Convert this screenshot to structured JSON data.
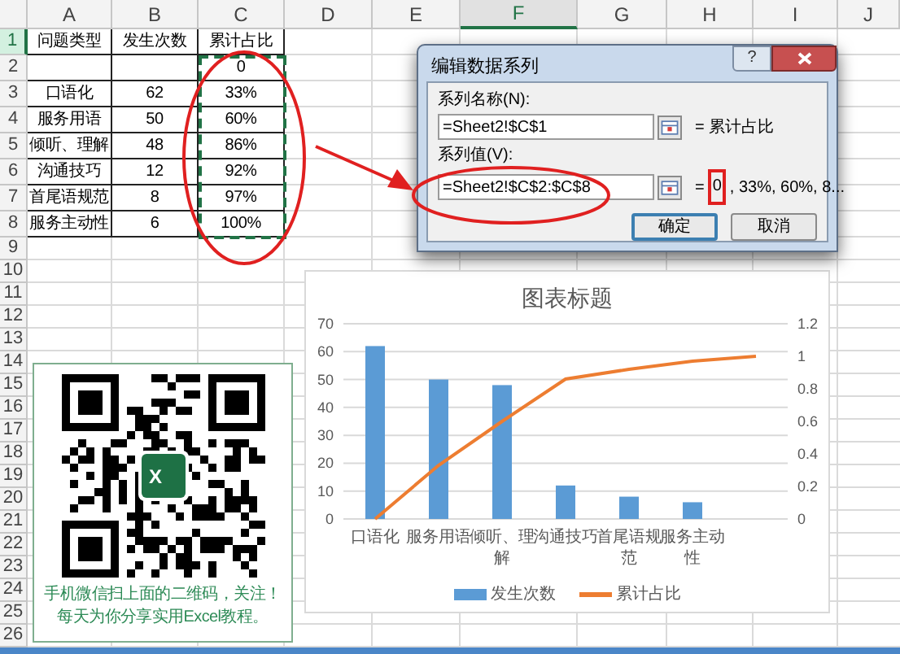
{
  "columns": [
    {
      "label": "A",
      "selected": false
    },
    {
      "label": "B",
      "selected": false
    },
    {
      "label": "C",
      "selected": false
    },
    {
      "label": "D",
      "selected": false
    },
    {
      "label": "E",
      "selected": false
    },
    {
      "label": "F",
      "selected": true
    },
    {
      "label": "G",
      "selected": false
    },
    {
      "label": "H",
      "selected": false
    },
    {
      "label": "I",
      "selected": false
    },
    {
      "label": "J",
      "selected": false
    }
  ],
  "rows": [
    {
      "label": "1",
      "selected": true
    },
    {
      "label": "2",
      "selected": false
    },
    {
      "label": "3",
      "selected": false
    },
    {
      "label": "4",
      "selected": false
    },
    {
      "label": "5",
      "selected": false
    },
    {
      "label": "6",
      "selected": false
    },
    {
      "label": "7",
      "selected": false
    },
    {
      "label": "8",
      "selected": false
    },
    {
      "label": "9",
      "selected": false
    },
    {
      "label": "10",
      "selected": false
    },
    {
      "label": "11",
      "selected": false
    },
    {
      "label": "12",
      "selected": false
    },
    {
      "label": "13",
      "selected": false
    },
    {
      "label": "14",
      "selected": false
    },
    {
      "label": "15",
      "selected": false
    },
    {
      "label": "16",
      "selected": false
    },
    {
      "label": "17",
      "selected": false
    },
    {
      "label": "18",
      "selected": false
    },
    {
      "label": "19",
      "selected": false
    },
    {
      "label": "20",
      "selected": false
    },
    {
      "label": "21",
      "selected": false
    },
    {
      "label": "22",
      "selected": false
    },
    {
      "label": "23",
      "selected": false
    },
    {
      "label": "24",
      "selected": false
    },
    {
      "label": "25",
      "selected": false
    },
    {
      "label": "26",
      "selected": false
    }
  ],
  "sheet": {
    "header": [
      "问题类型",
      "发生次数",
      "累计占比"
    ],
    "data_rows": [
      [
        null,
        null,
        "0"
      ],
      [
        "口语化",
        "62",
        "33%"
      ],
      [
        "服务用语",
        "50",
        "60%"
      ],
      [
        "倾听、理解",
        "48",
        "86%"
      ],
      [
        "沟通技巧",
        "12",
        "92%"
      ],
      [
        "首尾语规范",
        "8",
        "97%"
      ],
      [
        "服务主动性",
        "6",
        "100%"
      ]
    ],
    "copy_marquee": true
  },
  "dialog": {
    "title": "编辑数据系列",
    "help": "?",
    "name_label": "系列名称(N):",
    "name_value": "=Sheet2!$C$1",
    "name_preview": "= 累计占比",
    "values_label": "系列值(V):",
    "values_value": "=Sheet2!$C$2:$C$8",
    "values_preview": {
      "prefix": "=",
      "highlighted": "0",
      "rest": ", 33%, 60%, 8..."
    },
    "buttons": [
      {
        "label": "确定",
        "default": true
      },
      {
        "label": "取消",
        "default": false
      }
    ]
  },
  "chart": {
    "chart_data": {
      "type": "bar",
      "title": "图表标题",
      "categories": [
        "口语化",
        "服务用语",
        "倾听、理解",
        "沟通技巧",
        "首尾语规范",
        "服务主动性",
        null
      ],
      "series": [
        {
          "name": "发生次数",
          "color": "#5b9bd5",
          "values": [
            62,
            50,
            48,
            12,
            8,
            6,
            null
          ]
        },
        {
          "name": "累计占比",
          "color": "#ed7d31",
          "type": "line",
          "axis": "y2",
          "values": [
            0,
            0.33,
            0.6,
            0.86,
            0.92,
            0.97,
            1
          ]
        }
      ],
      "grid": true,
      "legend": true,
      "ylim": [
        0,
        70
      ],
      "yticks": [
        0,
        10,
        20,
        30,
        40,
        50,
        60,
        70
      ],
      "y2lim": [
        0,
        1.2
      ],
      "y2ticks": [
        0,
        0.2,
        0.4,
        0.6,
        0.8,
        1,
        1.2
      ]
    }
  },
  "qr_panel": {
    "logo_letter": "X",
    "captions": [
      "手机微信扫上面的二维码，关注！",
      "每天为你分享实用Excel教程。"
    ]
  }
}
